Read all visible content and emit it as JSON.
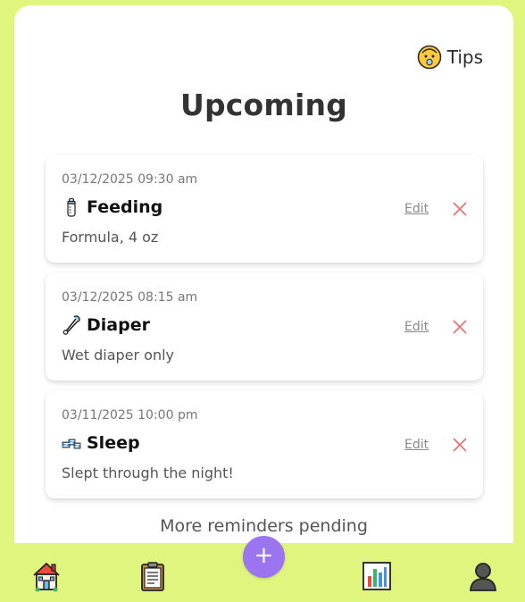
{
  "header": {
    "tips_label": "Tips",
    "title": "Upcoming"
  },
  "reminders": [
    {
      "datetime": "03/12/2025 09:30 am",
      "type": "Feeding",
      "icon": "baby-bottle-icon",
      "note": "Formula, 4 oz",
      "edit_label": "Edit"
    },
    {
      "datetime": "03/12/2025 08:15 am",
      "type": "Diaper",
      "icon": "safety-pin-icon",
      "note": "Wet diaper only",
      "edit_label": "Edit"
    },
    {
      "datetime": "03/11/2025 10:00 pm",
      "type": "Sleep",
      "icon": "zzz-icon",
      "note": "Slept through the night!",
      "edit_label": "Edit"
    }
  ],
  "footer_text": "More reminders pending",
  "nav": {
    "add_label": "+",
    "items": [
      "house-icon",
      "clipboard-icon",
      "bar-chart-icon",
      "user-silhouette-icon"
    ]
  },
  "colors": {
    "background": "#dff57e",
    "accent": "#9b74f0",
    "delete": "#e57373"
  }
}
